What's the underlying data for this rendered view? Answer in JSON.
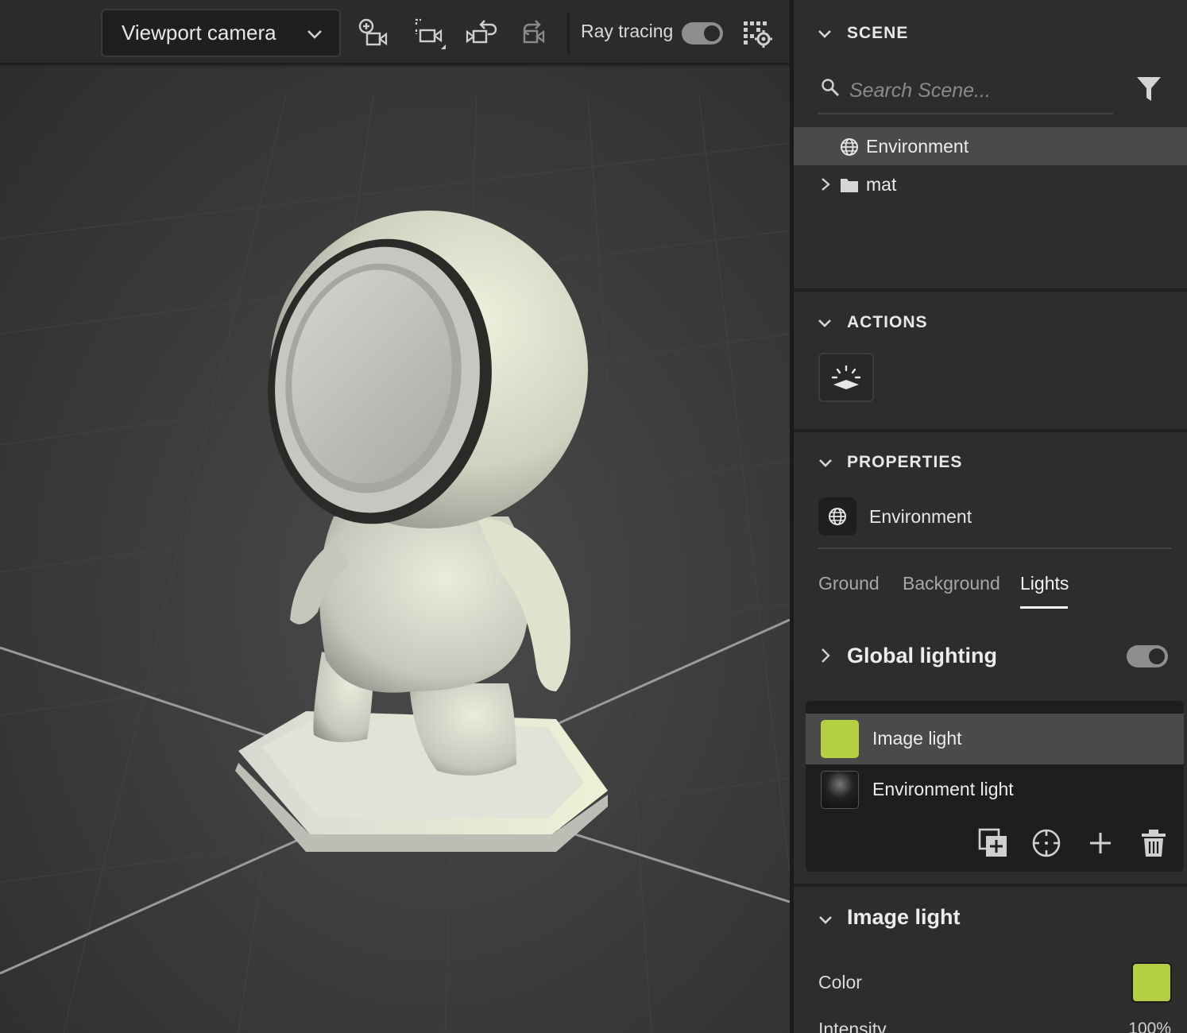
{
  "toolbar": {
    "camera_select": "Viewport camera",
    "ray_tracing_label": "Ray tracing",
    "ray_tracing_on": true,
    "icons": [
      "add-camera-icon",
      "frame-camera-icon",
      "undo-camera-icon",
      "redo-camera-icon",
      "render-settings-icon"
    ]
  },
  "scene": {
    "title": "SCENE",
    "search_placeholder": "Search Scene...",
    "items": [
      {
        "label": "Environment",
        "icon": "globe-icon",
        "selected": true
      },
      {
        "label": "mat",
        "icon": "folder-icon",
        "selected": false
      }
    ]
  },
  "actions": {
    "title": "ACTIONS",
    "buttons": [
      "drop-to-ground-icon"
    ]
  },
  "properties": {
    "title": "PROPERTIES",
    "object_name": "Environment",
    "tabs": [
      {
        "label": "Ground",
        "active": false
      },
      {
        "label": "Background",
        "active": false
      },
      {
        "label": "Lights",
        "active": true
      }
    ],
    "global_lighting": {
      "label": "Global lighting",
      "enabled": true
    },
    "lights": [
      {
        "label": "Image light",
        "swatch": "#b5cf45",
        "selected": true
      },
      {
        "label": "Environment light",
        "selected": false
      }
    ],
    "image_light": {
      "title": "Image light",
      "color_label": "Color",
      "color": "#b5cf45",
      "intensity_label": "Intensity",
      "intensity_value": "100%"
    }
  },
  "colors": {
    "accent_light": "#b5cf45",
    "panel_bg": "#2d2d2d",
    "selection": "#4a4a4a"
  }
}
